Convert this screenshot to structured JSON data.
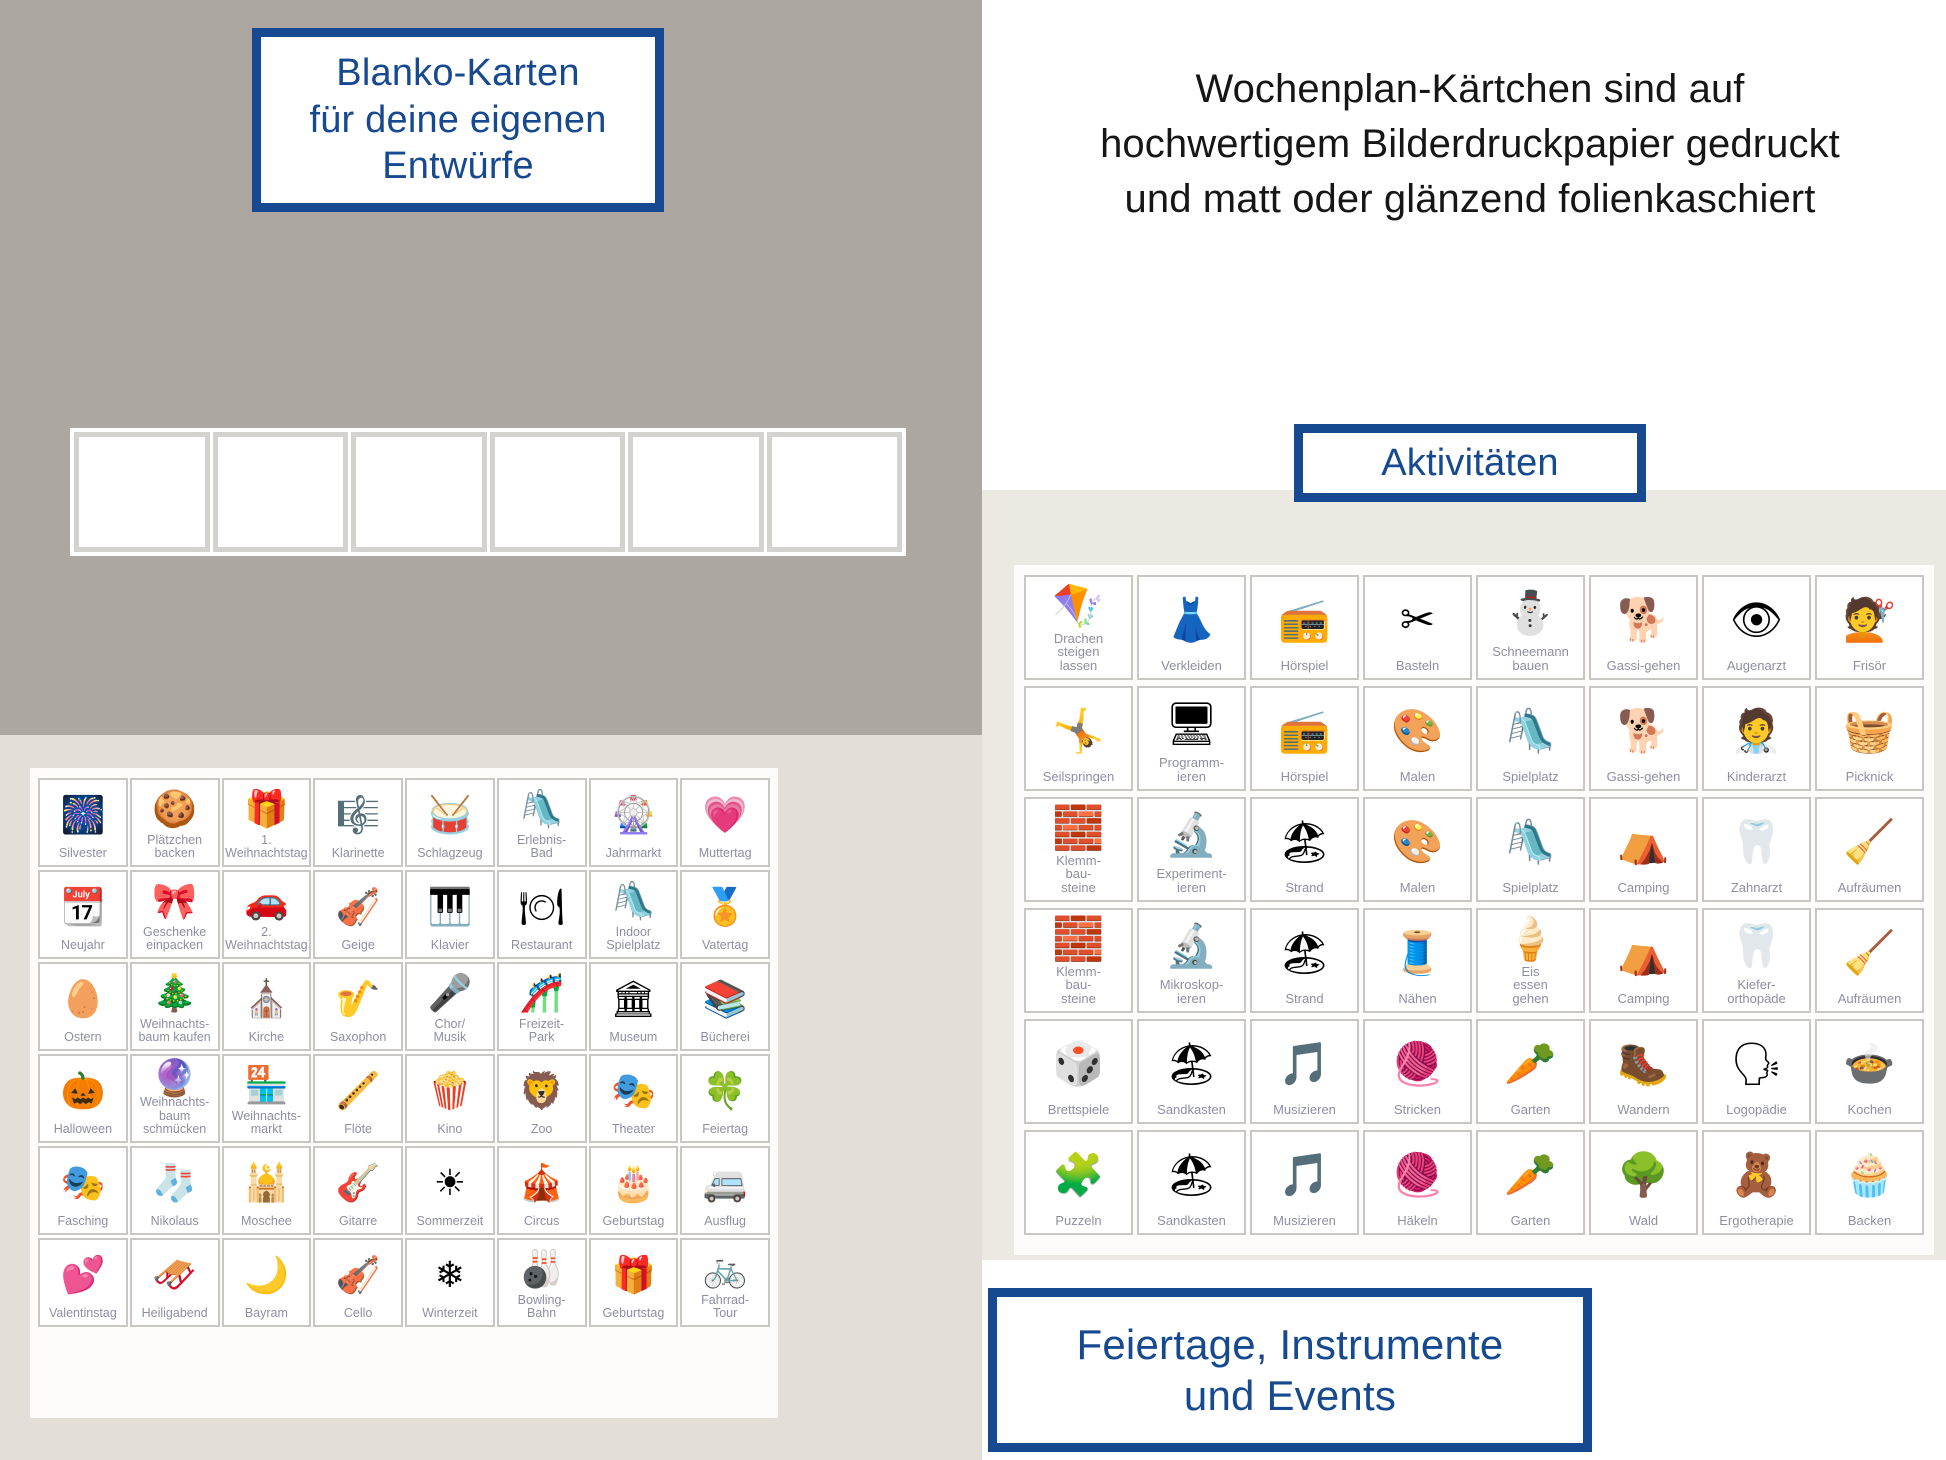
{
  "page": {
    "background_gray": "#aca8a1",
    "background_cream": "#ece8e2",
    "accent_blue": "#16498f",
    "caption_color": "#8e8ea3"
  },
  "banners": {
    "blanko": "Blanko-Karten\nfür deine eigenen\nEntwürfe",
    "aktivitaeten": "Aktivitäten",
    "feiertage": "Feiertage, Instrumente\nund Events"
  },
  "intro_text": "Wochenplan-Kärtchen sind auf hochwertigem Bilderdruckpapier gedruckt und matt oder glänzend folienkaschiert",
  "blank_cards": {
    "count": 6,
    "label": ""
  },
  "events_sheet": {
    "columns": 8,
    "rows": 7,
    "cards": [
      {
        "label": "Silvester",
        "icon": "fireworks-icon",
        "glyph": "🎆"
      },
      {
        "label": "Plätzchen\nbacken",
        "icon": "cookie-dough-icon",
        "glyph": "🍪"
      },
      {
        "label": "1.\nWeihnachtstag",
        "icon": "gift-stack-icon",
        "glyph": "🎁"
      },
      {
        "label": "Klarinette",
        "icon": "clarinet-icon",
        "glyph": "🎼"
      },
      {
        "label": "Schlagzeug",
        "icon": "drum-kit-icon",
        "glyph": "🥁"
      },
      {
        "label": "Erlebnis-\nBad",
        "icon": "water-slide-icon",
        "glyph": "🛝"
      },
      {
        "label": "Jahrmarkt",
        "icon": "ferris-wheel-icon",
        "glyph": "🎡"
      },
      {
        "label": "Muttertag",
        "icon": "best-mom-ever-icon",
        "glyph": "💗"
      },
      {
        "label": "Neujahr",
        "icon": "calendar-jan1-icon",
        "glyph": "📆"
      },
      {
        "label": "Geschenke\neinpacken",
        "icon": "scissors-ribbon-icon",
        "glyph": "🎀"
      },
      {
        "label": "2.\nWeihnachtstag",
        "icon": "red-car-gifts-icon",
        "glyph": "🚗"
      },
      {
        "label": "Geige",
        "icon": "violin-icon",
        "glyph": "🎻"
      },
      {
        "label": "Klavier",
        "icon": "upright-piano-icon",
        "glyph": "🎹"
      },
      {
        "label": "Restaurant",
        "icon": "restaurant-icon",
        "glyph": "🍽"
      },
      {
        "label": "Indoor\nSpielplatz",
        "icon": "indoor-playground-icon",
        "glyph": "🛝"
      },
      {
        "label": "Vatertag",
        "icon": "awesome-dad-icon",
        "glyph": "🏅"
      },
      {
        "label": "Ostern",
        "icon": "easter-eggs-icon",
        "glyph": "🥚"
      },
      {
        "label": "Weihnachts-\nbaum kaufen",
        "icon": "christmas-tree-icon",
        "glyph": "🎄"
      },
      {
        "label": "Kirche",
        "icon": "church-icon",
        "glyph": "⛪"
      },
      {
        "label": "Saxophon",
        "icon": "saxophone-icon",
        "glyph": "🎷"
      },
      {
        "label": "Chor/\nMusik",
        "icon": "microphone-icon",
        "glyph": "🎤"
      },
      {
        "label": "Freizeit-\nPark",
        "icon": "roller-coaster-icon",
        "glyph": "🎢"
      },
      {
        "label": "Museum",
        "icon": "museum-icon",
        "glyph": "🏛"
      },
      {
        "label": "Bücherei",
        "icon": "bookshelf-icon",
        "glyph": "📚"
      },
      {
        "label": "Halloween",
        "icon": "pumpkin-icon",
        "glyph": "🎃"
      },
      {
        "label": "Weihnachts-\nbaum\nschmücken",
        "icon": "ornaments-icon",
        "glyph": "🔮"
      },
      {
        "label": "Weihnachts-\nmarkt",
        "icon": "christmas-market-icon",
        "glyph": "🏪"
      },
      {
        "label": "Flöte",
        "icon": "recorder-flute-icon",
        "glyph": "🪈"
      },
      {
        "label": "Kino",
        "icon": "popcorn-icon",
        "glyph": "🍿"
      },
      {
        "label": "Zoo",
        "icon": "zoo-gate-icon",
        "glyph": "🦁"
      },
      {
        "label": "Theater",
        "icon": "red-curtain-icon",
        "glyph": "🎭"
      },
      {
        "label": "Feiertag",
        "icon": "four-leaf-clover-icon",
        "glyph": "🍀"
      },
      {
        "label": "Fasching",
        "icon": "carnival-mask-icon",
        "glyph": "🎭"
      },
      {
        "label": "Nikolaus",
        "icon": "christmas-stocking-icon",
        "glyph": "🧦"
      },
      {
        "label": "Moschee",
        "icon": "mosque-icon",
        "glyph": "🕌"
      },
      {
        "label": "Gitarre",
        "icon": "guitar-icon",
        "glyph": "🎸"
      },
      {
        "label": "Sommerzeit",
        "icon": "sun-clock-icon",
        "glyph": "☀"
      },
      {
        "label": "Circus",
        "icon": "circus-tent-icon",
        "glyph": "🎪"
      },
      {
        "label": "Geburtstag",
        "icon": "birthday-cake-icon",
        "glyph": "🎂"
      },
      {
        "label": "Ausflug",
        "icon": "camper-van-icon",
        "glyph": "🚐"
      },
      {
        "label": "Valentinstag",
        "icon": "love-birds-icon",
        "glyph": "💕"
      },
      {
        "label": "Heiligabend",
        "icon": "santa-sleigh-icon",
        "glyph": "🛷"
      },
      {
        "label": "Bayram",
        "icon": "crescent-moon-icon",
        "glyph": "🌙"
      },
      {
        "label": "Cello",
        "icon": "cello-icon",
        "glyph": "🎻"
      },
      {
        "label": "Winterzeit",
        "icon": "snowflake-clock-icon",
        "glyph": "❄"
      },
      {
        "label": "Bowling-\nBahn",
        "icon": "bowling-pins-icon",
        "glyph": "🎳"
      },
      {
        "label": "Geburtstag",
        "icon": "gift-box-icon",
        "glyph": "🎁"
      },
      {
        "label": "Fahrrad-\nTour",
        "icon": "bicycle-icon",
        "glyph": "🚲"
      }
    ]
  },
  "activities_sheet": {
    "columns": 8,
    "rows": 6,
    "cards": [
      {
        "label": "Drachen\nsteigen\nlassen",
        "icon": "kite-icon",
        "glyph": "🪁"
      },
      {
        "label": "Verkleiden",
        "icon": "dress-up-icon",
        "glyph": "👗"
      },
      {
        "label": "Hörspiel",
        "icon": "radio-icon",
        "glyph": "📻"
      },
      {
        "label": "Basteln",
        "icon": "scissors-glue-icon",
        "glyph": "✂"
      },
      {
        "label": "Schneemann\nbauen",
        "icon": "snowman-icon",
        "glyph": "⛄"
      },
      {
        "label": "Gassi-gehen",
        "icon": "dog-walk-icon",
        "glyph": "🐕"
      },
      {
        "label": "Augenarzt",
        "icon": "eye-chart-icon",
        "glyph": "👁"
      },
      {
        "label": "Frisör",
        "icon": "scissors-comb-icon",
        "glyph": "💇"
      },
      {
        "label": "Seilspringen",
        "icon": "jump-rope-icon",
        "glyph": "🤸"
      },
      {
        "label": "Programm-\nieren",
        "icon": "computer-icon",
        "glyph": "🖥"
      },
      {
        "label": "Hörspiel",
        "icon": "radio-icon",
        "glyph": "📻"
      },
      {
        "label": "Malen",
        "icon": "paint-box-icon",
        "glyph": "🎨"
      },
      {
        "label": "Spielplatz",
        "icon": "playground-slide-icon",
        "glyph": "🛝"
      },
      {
        "label": "Gassi-gehen",
        "icon": "dog-hug-icon",
        "glyph": "🐕"
      },
      {
        "label": "Kinderarzt",
        "icon": "pediatrician-icon",
        "glyph": "🧑‍⚕"
      },
      {
        "label": "Picknick",
        "icon": "picnic-basket-icon",
        "glyph": "🧺"
      },
      {
        "label": "Klemm-\nbau-\nsteine",
        "icon": "building-bricks-icon",
        "glyph": "🧱"
      },
      {
        "label": "Experiment-\nieren",
        "icon": "lab-kids-icon",
        "glyph": "🔬"
      },
      {
        "label": "Strand",
        "icon": "beach-surf-icon",
        "glyph": "🏖"
      },
      {
        "label": "Malen",
        "icon": "paint-box-icon",
        "glyph": "🎨"
      },
      {
        "label": "Spielplatz",
        "icon": "playground-slide-icon",
        "glyph": "🛝"
      },
      {
        "label": "Camping",
        "icon": "tent-trees-icon",
        "glyph": "⛺"
      },
      {
        "label": "Zahnarzt",
        "icon": "tooth-icon",
        "glyph": "🦷"
      },
      {
        "label": "Aufräumen",
        "icon": "tidy-room-icon",
        "glyph": "🧹"
      },
      {
        "label": "Klemm-\nbau-\nsteine",
        "icon": "building-bricks-icon",
        "glyph": "🧱"
      },
      {
        "label": "Mikroskop-\nieren",
        "icon": "microscope-icon",
        "glyph": "🔬"
      },
      {
        "label": "Strand",
        "icon": "beach-surf-icon",
        "glyph": "🏖"
      },
      {
        "label": "Nähen",
        "icon": "sewing-machine-icon",
        "glyph": "🧵"
      },
      {
        "label": "Eis\nessen\ngehen",
        "icon": "ice-cream-icon",
        "glyph": "🍦"
      },
      {
        "label": "Camping",
        "icon": "tent-trees-icon",
        "glyph": "⛺"
      },
      {
        "label": "Kiefer-\northopäde",
        "icon": "braces-icon",
        "glyph": "🦷"
      },
      {
        "label": "Aufräumen",
        "icon": "tidy-room-icon",
        "glyph": "🧹"
      },
      {
        "label": "Brettspiele",
        "icon": "board-game-icon",
        "glyph": "🎲"
      },
      {
        "label": "Sandkasten",
        "icon": "sandbox-icon",
        "glyph": "🏖"
      },
      {
        "label": "Musizieren",
        "icon": "music-notes-icon",
        "glyph": "🎵"
      },
      {
        "label": "Stricken",
        "icon": "knitting-icon",
        "glyph": "🧶"
      },
      {
        "label": "Garten",
        "icon": "vegetable-basket-icon",
        "glyph": "🥕"
      },
      {
        "label": "Wandern",
        "icon": "hiking-map-icon",
        "glyph": "🥾"
      },
      {
        "label": "Logopädie",
        "icon": "speech-therapy-icon",
        "glyph": "🗣"
      },
      {
        "label": "Kochen",
        "icon": "cooking-pot-icon",
        "glyph": "🍲"
      },
      {
        "label": "Puzzeln",
        "icon": "puzzle-icon",
        "glyph": "🧩"
      },
      {
        "label": "Sandkasten",
        "icon": "sandbox-icon",
        "glyph": "🏖"
      },
      {
        "label": "Musizieren",
        "icon": "music-notes-icon",
        "glyph": "🎵"
      },
      {
        "label": "Häkeln",
        "icon": "crochet-icon",
        "glyph": "🧶"
      },
      {
        "label": "Garten",
        "icon": "vegetable-basket-icon",
        "glyph": "🥕"
      },
      {
        "label": "Wald",
        "icon": "forest-icon",
        "glyph": "🌳"
      },
      {
        "label": "Ergotherapie",
        "icon": "occupational-therapy-icon",
        "glyph": "🧸"
      },
      {
        "label": "Backen",
        "icon": "stand-mixer-icon",
        "glyph": "🧁"
      }
    ]
  }
}
